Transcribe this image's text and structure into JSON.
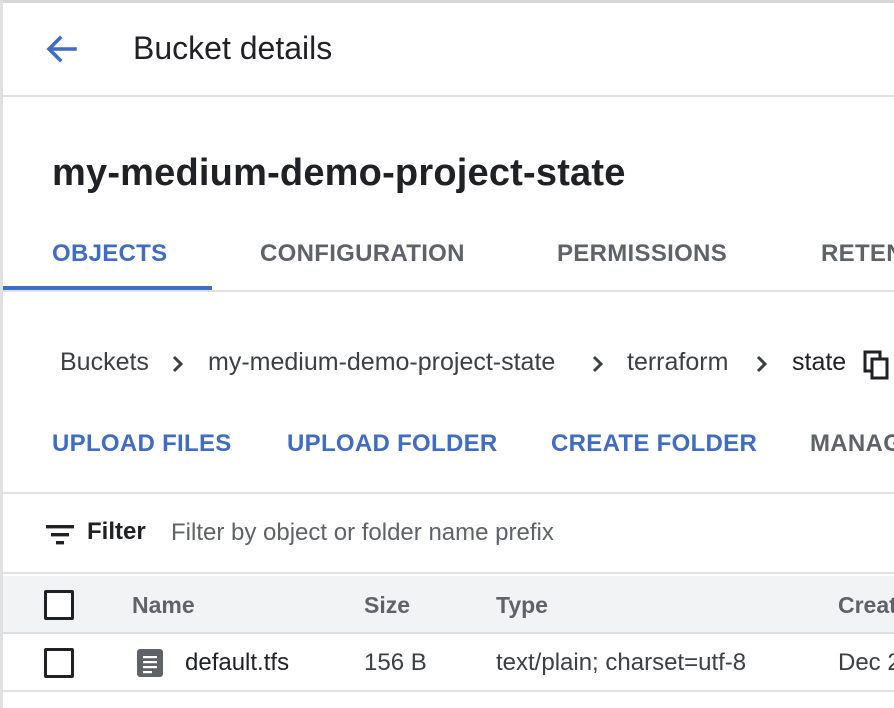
{
  "header": {
    "title": "Bucket details"
  },
  "bucket": {
    "name": "my-medium-demo-project-state"
  },
  "tabs": [
    {
      "label": "OBJECTS",
      "active": true
    },
    {
      "label": "CONFIGURATION",
      "active": false
    },
    {
      "label": "PERMISSIONS",
      "active": false
    },
    {
      "label": "RETEN",
      "active": false
    }
  ],
  "breadcrumb": {
    "items": [
      "Buckets",
      "my-medium-demo-project-state",
      "terraform",
      "state"
    ]
  },
  "actions": {
    "upload_files": "UPLOAD FILES",
    "upload_folder": "UPLOAD FOLDER",
    "create_folder": "CREATE FOLDER",
    "manage": "MANAG"
  },
  "filter": {
    "label": "Filter",
    "placeholder": "Filter by object or folder name prefix"
  },
  "table": {
    "columns": [
      "Name",
      "Size",
      "Type",
      "Creat"
    ],
    "rows": [
      {
        "name": "default.tfs",
        "size": "156 B",
        "type": "text/plain; charset=utf-8",
        "created": "Dec 2"
      }
    ]
  },
  "colors": {
    "accent": "#3f6cc4",
    "text": "#202124",
    "muted": "#5f6368",
    "divider": "#e0e0e0",
    "header_bg": "#f1f3f4"
  },
  "icons": {
    "back": "arrow-back-icon",
    "chevron": "chevron-right-icon",
    "copy": "copy-icon",
    "filter": "filter-list-icon",
    "file": "file-document-icon",
    "checkbox": "checkbox-icon"
  }
}
